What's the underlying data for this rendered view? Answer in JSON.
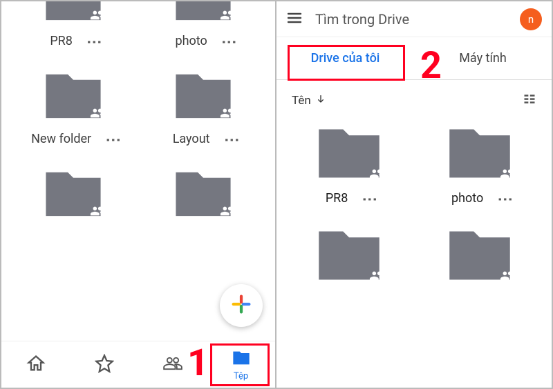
{
  "left": {
    "folders": [
      {
        "name": "PR8"
      },
      {
        "name": "photo"
      },
      {
        "name": "New folder"
      },
      {
        "name": "Layout"
      }
    ],
    "nav": {
      "files": "Tệp"
    },
    "annotation": "1"
  },
  "right": {
    "search_placeholder": "Tìm trong Drive",
    "avatar_initial": "n",
    "tabs": {
      "mydrive": "Drive của tôi",
      "computers": "Máy tính"
    },
    "sort_label": "Tên",
    "folders": [
      {
        "name": "PR8"
      },
      {
        "name": "photo"
      }
    ],
    "annotation": "2"
  }
}
